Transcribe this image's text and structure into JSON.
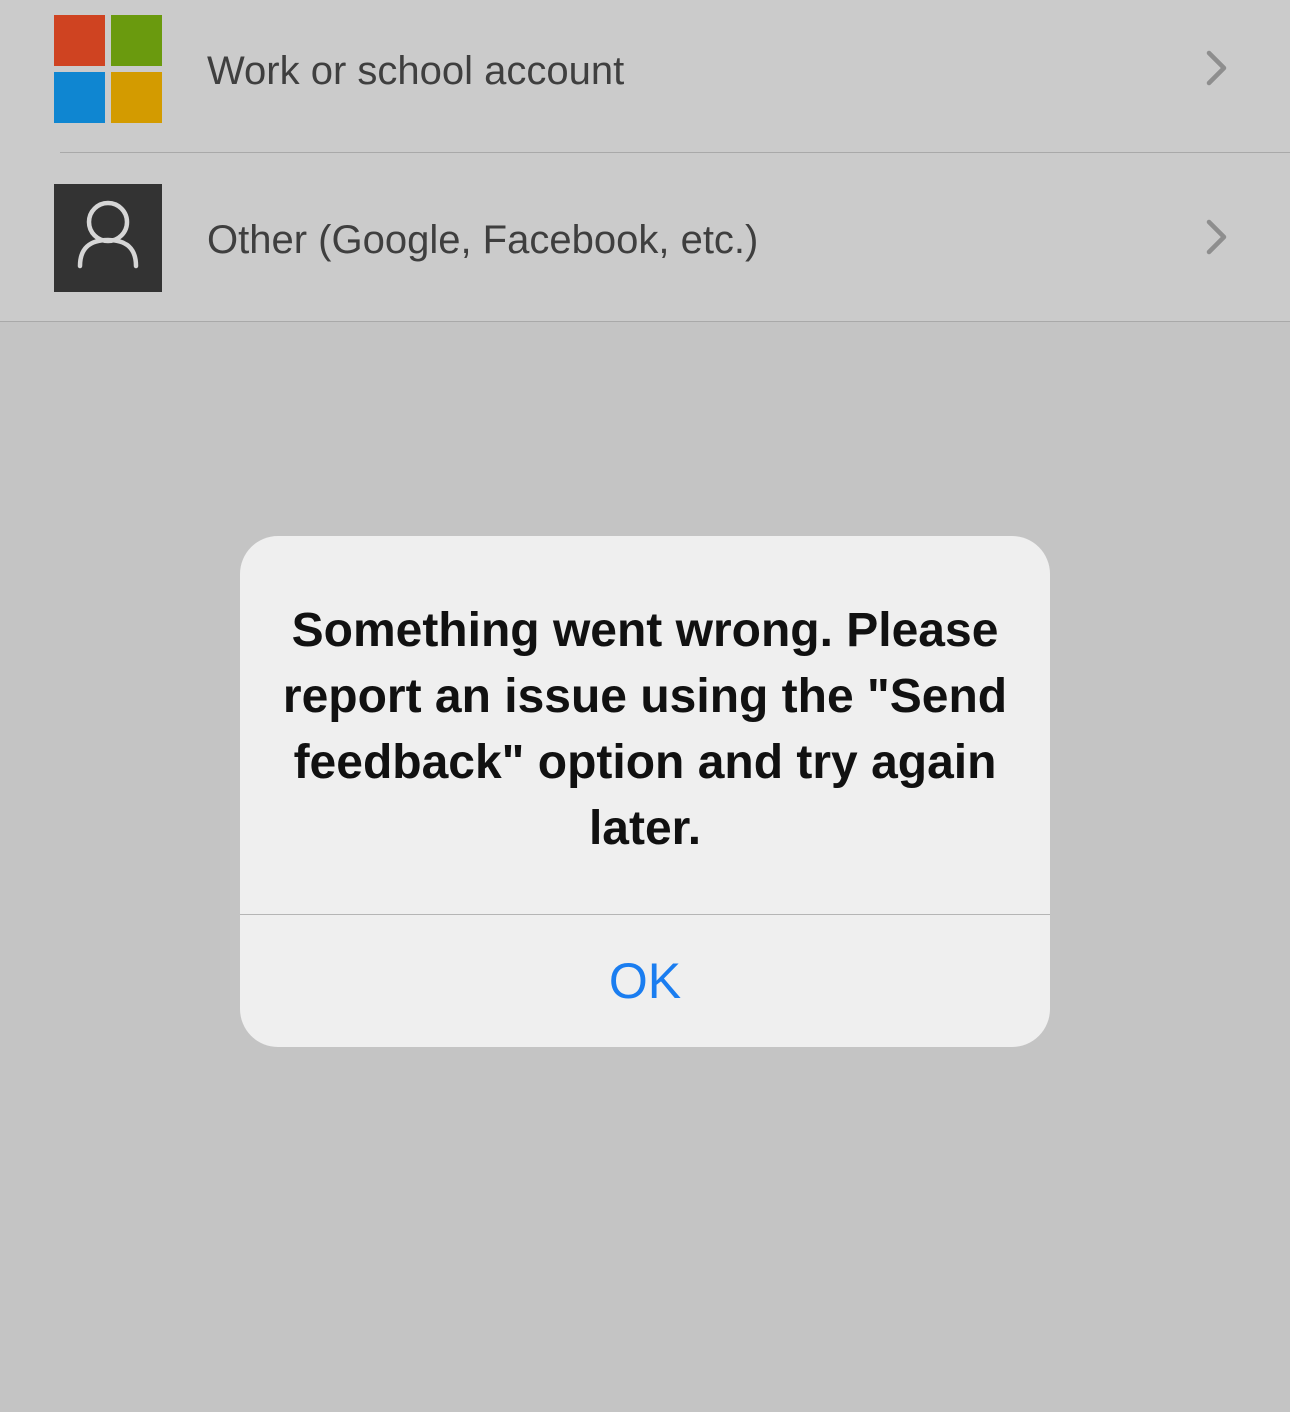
{
  "accounts": {
    "work": {
      "label": "Work or school account",
      "icon": "microsoft-logo-icon",
      "logo_colors": [
        "#cf4321",
        "#6a9a0e",
        "#0f86d1",
        "#d39b00"
      ]
    },
    "other": {
      "label": "Other (Google, Facebook, etc.)",
      "icon": "person-icon"
    }
  },
  "alert": {
    "message": "Something went wrong. Please report an issue using the \"Send feedback\" option and try again later.",
    "ok_label": "OK"
  },
  "colors": {
    "accent": "#1a7df0",
    "backdrop": "#c4c4c4",
    "list_background": "#cbcbcb",
    "alert_background": "#efefef"
  }
}
